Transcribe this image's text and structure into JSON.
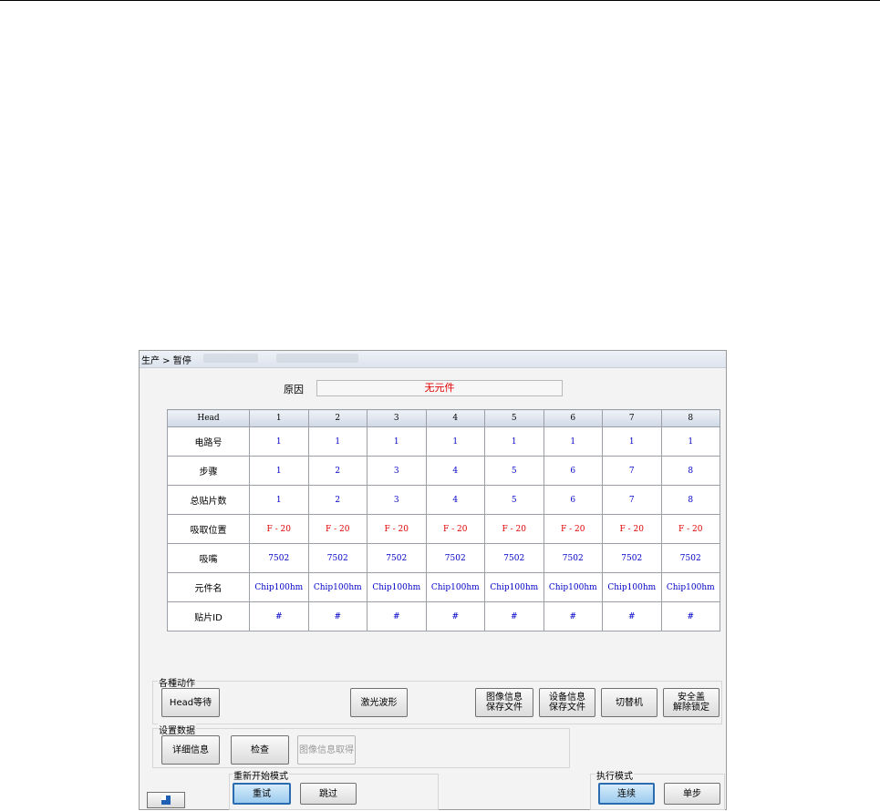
{
  "window": {
    "breadcrumb": "生产 > 暂停"
  },
  "reason": {
    "label": "原因",
    "value": "无元件"
  },
  "grid": {
    "header": [
      "Head",
      "1",
      "2",
      "3",
      "4",
      "5",
      "6",
      "7",
      "8"
    ],
    "rows": [
      {
        "label": "电路号",
        "cells": [
          "1",
          "1",
          "1",
          "1",
          "1",
          "1",
          "1",
          "1"
        ]
      },
      {
        "label": "步骤",
        "cells": [
          "1",
          "2",
          "3",
          "4",
          "5",
          "6",
          "7",
          "8"
        ]
      },
      {
        "label": "总贴片数",
        "cells": [
          "1",
          "2",
          "3",
          "4",
          "5",
          "6",
          "7",
          "8"
        ]
      },
      {
        "label": "吸取位置",
        "cells": [
          "F - 20",
          "F - 20",
          "F - 20",
          "F - 20",
          "F - 20",
          "F - 20",
          "F - 20",
          "F - 20"
        ]
      },
      {
        "label": "吸嘴",
        "cells": [
          "7502",
          "7502",
          "7502",
          "7502",
          "7502",
          "7502",
          "7502",
          "7502"
        ]
      },
      {
        "label": "元件名",
        "cells": [
          "Chip100hm",
          "Chip100hm",
          "Chip100hm",
          "Chip100hm",
          "Chip100hm",
          "Chip100hm",
          "Chip100hm",
          "Chip100hm"
        ]
      },
      {
        "label": "贴片ID",
        "cells": [
          "#",
          "#",
          "#",
          "#",
          "#",
          "#",
          "#",
          "#"
        ]
      }
    ]
  },
  "actions": {
    "label": "各種动作",
    "head_wait": "Head等待",
    "laser_waveform": "激光波形",
    "image_info_save": "图像信息\n保存文件",
    "device_info_save": "设备信息\n保存文件",
    "switch_machine": "切替机",
    "safety_unlock": "安全盖\n解除锁定"
  },
  "settings": {
    "label": "设置数据",
    "details": "详细信息",
    "inspect": "检查",
    "image_info_get": "图像信息取得"
  },
  "restart_mode": {
    "label": "重新开始模式",
    "retry": "重试",
    "skip": "跳过"
  },
  "exec_mode": {
    "label": "执行模式",
    "continuous": "连续",
    "single_step": "单步"
  },
  "colors": {
    "error_text": "#e00000",
    "value_text": "#0000c8",
    "active_border": "#2b6cb0"
  }
}
